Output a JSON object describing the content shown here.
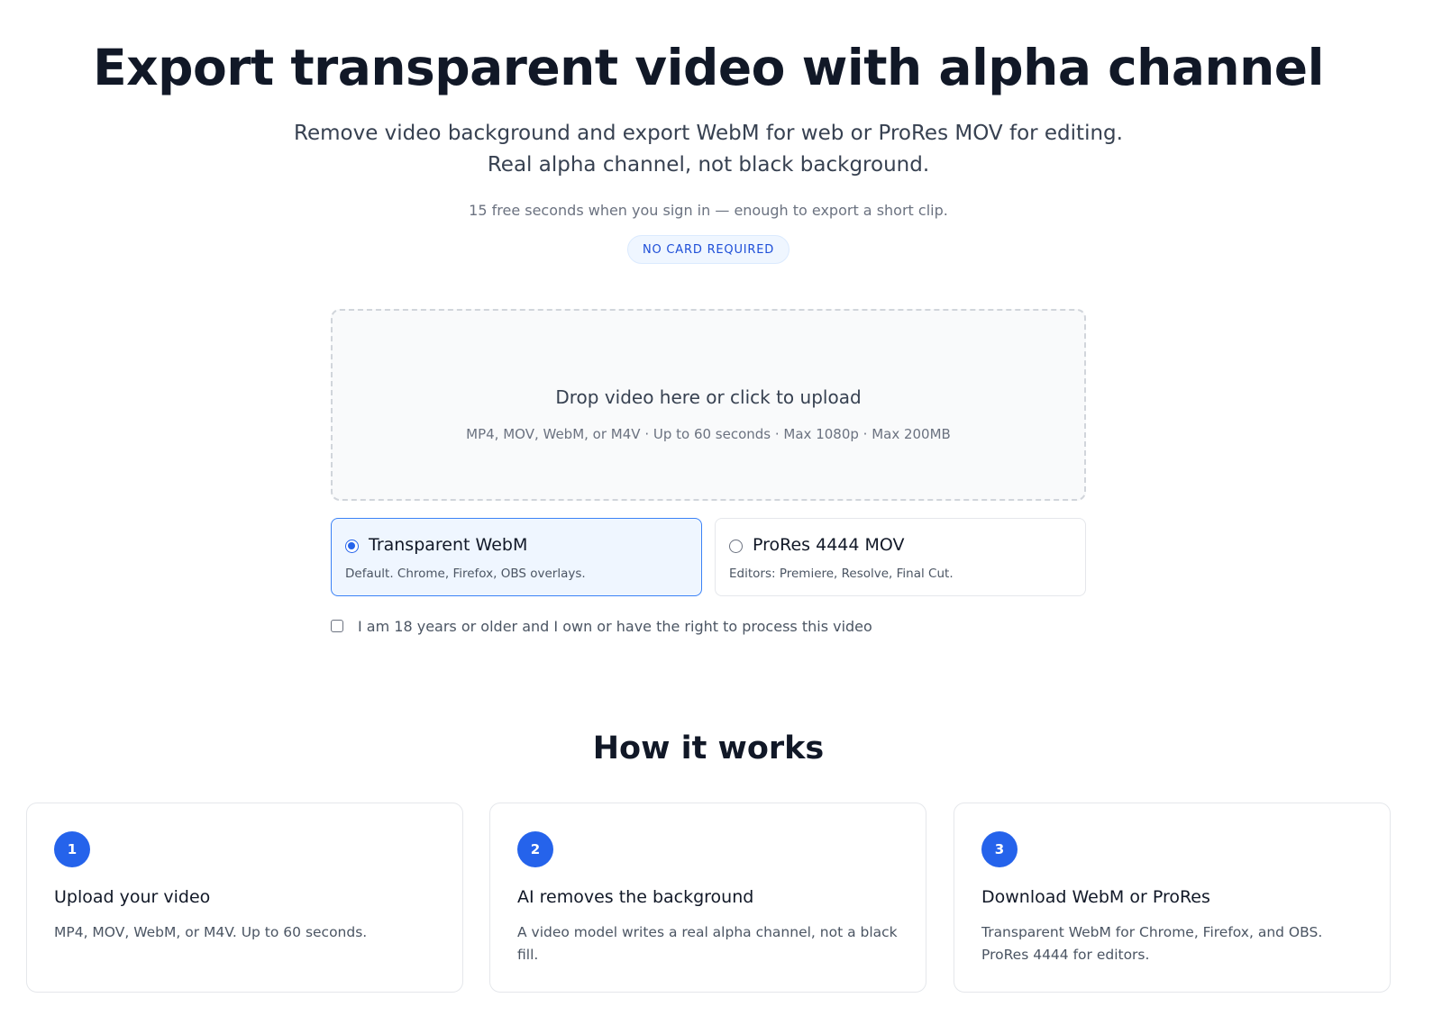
{
  "hero": {
    "title": "Export transparent video with alpha channel",
    "subtitle": "Remove video background and export WebM for web or ProRes MOV for editing. Real alpha channel, not black background.",
    "free_note": "15 free seconds when you sign in — enough to export a short clip.",
    "badge": "NO CARD REQUIRED"
  },
  "upload": {
    "title": "Drop video here or click to upload",
    "hint": "MP4, MOV, WebM, or M4V · Up to 60 seconds · Max 1080p · Max 200MB"
  },
  "formats": [
    {
      "label": "Transparent WebM",
      "description": "Default. Chrome, Firefox, OBS overlays.",
      "selected": true
    },
    {
      "label": "ProRes 4444 MOV",
      "description": "Editors: Premiere, Resolve, Final Cut.",
      "selected": false
    }
  ],
  "consent": {
    "label": "I am 18 years or older and I own or have the right to process this video",
    "checked": false
  },
  "how_it_works": {
    "title": "How it works",
    "steps": [
      {
        "number": "1",
        "title": "Upload your video",
        "description": "MP4, MOV, WebM, or M4V. Up to 60 seconds."
      },
      {
        "number": "2",
        "title": "AI removes the background",
        "description": "A video model writes a real alpha channel, not a black fill."
      },
      {
        "number": "3",
        "title": "Download WebM or ProRes",
        "description": "Transparent WebM for Chrome, Firefox, and OBS. ProRes 4444 for editors."
      }
    ]
  },
  "colors": {
    "accent": "#2563eb",
    "selected_bg": "#eff6ff",
    "text_primary": "#111827",
    "text_muted": "#6b7280"
  }
}
